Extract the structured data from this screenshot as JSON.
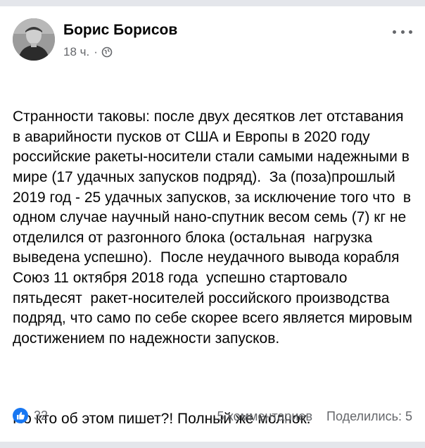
{
  "post": {
    "author": "Борис Борисов",
    "time": "18 ч.",
    "separator": "·",
    "privacy_icon": "globe-icon",
    "paragraphs": [
      "Странности таковы: после двух десятков лет отставания в аварийности пусков от США и Европы в 2020 году российские ракеты-носители стали самыми надежными в мире (17 удачных запусков подряд).  За (поза)прошлый 2019 год - 25 удачных запусков, за исключение того что  в одном случае научный нано-спутник весом семь (7) кг не отделился от разгонного блока (остальная  нагрузка выведена успешно).  После неудачного вывода корабля Союз 11 октября 2018 года  успешно стартовало пятьдесят  ракет-носителей российского производства подряд, что само по себе скорее всего является мировым достижением по надежности запусков.",
      "Но кто об этом пишет?! Полный же молчок."
    ]
  },
  "footer": {
    "reaction_icon": "like-icon",
    "reaction_count": "32",
    "comments": "5 комментариев",
    "shares": "Поделились: 5"
  },
  "colors": {
    "like_blue": "#1877f2",
    "secondary_text": "#65676b",
    "background_gap": "#e4e6eb"
  }
}
